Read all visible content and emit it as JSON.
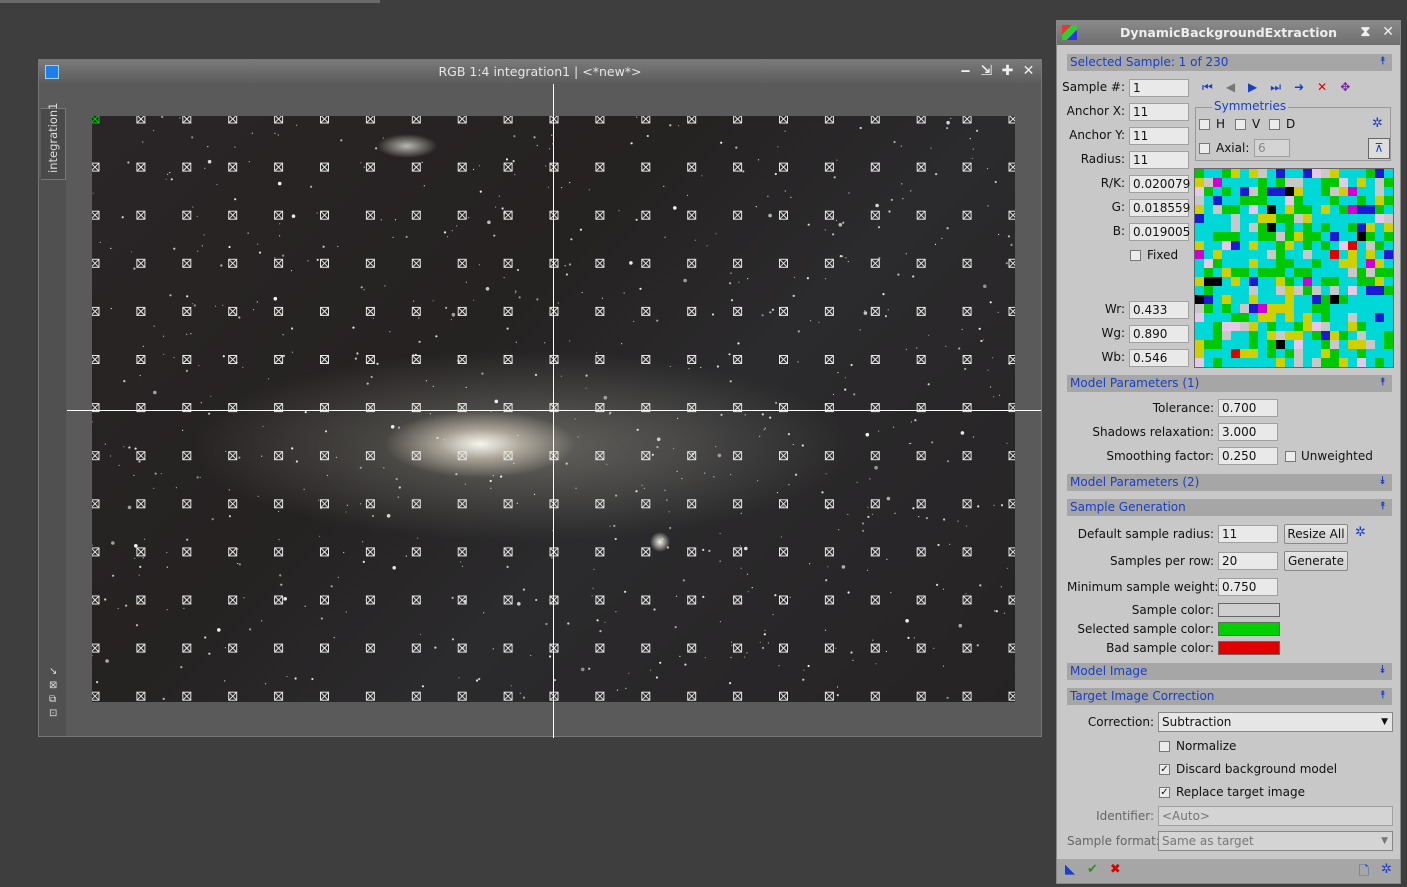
{
  "image_window": {
    "title": "RGB 1:4 integration1 | <*new*>",
    "side_tab": "integration1",
    "buttons": {
      "minimize": "‒",
      "shade": "⇲",
      "maximize": "✚",
      "close": "✕"
    }
  },
  "dbe": {
    "title": "DynamicBackgroundExtraction",
    "title_buttons": {
      "shade": "⧗",
      "close": "✕"
    },
    "selected_sample": {
      "header": "Selected Sample: 1 of 230",
      "sample_num_label": "Sample #:",
      "sample_num": "1",
      "anchor_x_label": "Anchor X:",
      "anchor_x": "11",
      "anchor_y_label": "Anchor Y:",
      "anchor_y": "11",
      "radius_label": "Radius:",
      "radius": "11",
      "rk_label": "R/K:",
      "rk": "0.020079",
      "g_label": "G:",
      "g": "0.018559",
      "b_label": "B:",
      "b": "0.019005",
      "fixed_label": "Fixed",
      "wr_label": "Wr:",
      "wr": "0.433",
      "wg_label": "Wg:",
      "wg": "0.890",
      "wb_label": "Wb:",
      "wb": "0.546",
      "symmetries_label": "Symmetries",
      "h_label": "H",
      "v_label": "V",
      "d_label": "D",
      "axial_label": "Axial:",
      "axial": "6"
    },
    "model_params_1": {
      "header": "Model Parameters (1)",
      "tolerance_label": "Tolerance:",
      "tolerance": "0.700",
      "shadows_label": "Shadows relaxation:",
      "shadows": "3.000",
      "smoothing_label": "Smoothing factor:",
      "smoothing": "0.250",
      "unweighted_label": "Unweighted"
    },
    "model_params_2": {
      "header": "Model Parameters (2)"
    },
    "sample_generation": {
      "header": "Sample Generation",
      "default_radius_label": "Default sample radius:",
      "default_radius": "11",
      "resize_all": "Resize All",
      "per_row_label": "Samples per row:",
      "per_row": "20",
      "generate": "Generate",
      "min_weight_label": "Minimum sample weight:",
      "min_weight": "0.750",
      "sample_color_label": "Sample color:",
      "sample_color": "#cfcfcf",
      "selected_color_label": "Selected sample color:",
      "selected_color": "#00d000",
      "bad_color_label": "Bad sample color:",
      "bad_color": "#e00000"
    },
    "model_image": {
      "header": "Model Image"
    },
    "target_correction": {
      "header": "Target Image Correction",
      "correction_label": "Correction:",
      "correction": "Subtraction",
      "normalize_label": "Normalize",
      "discard_label": "Discard background model",
      "replace_label": "Replace target image",
      "identifier_label": "Identifier:",
      "identifier_placeholder": "<Auto>",
      "sample_format_label": "Sample format:",
      "sample_format": "Same as target"
    }
  }
}
